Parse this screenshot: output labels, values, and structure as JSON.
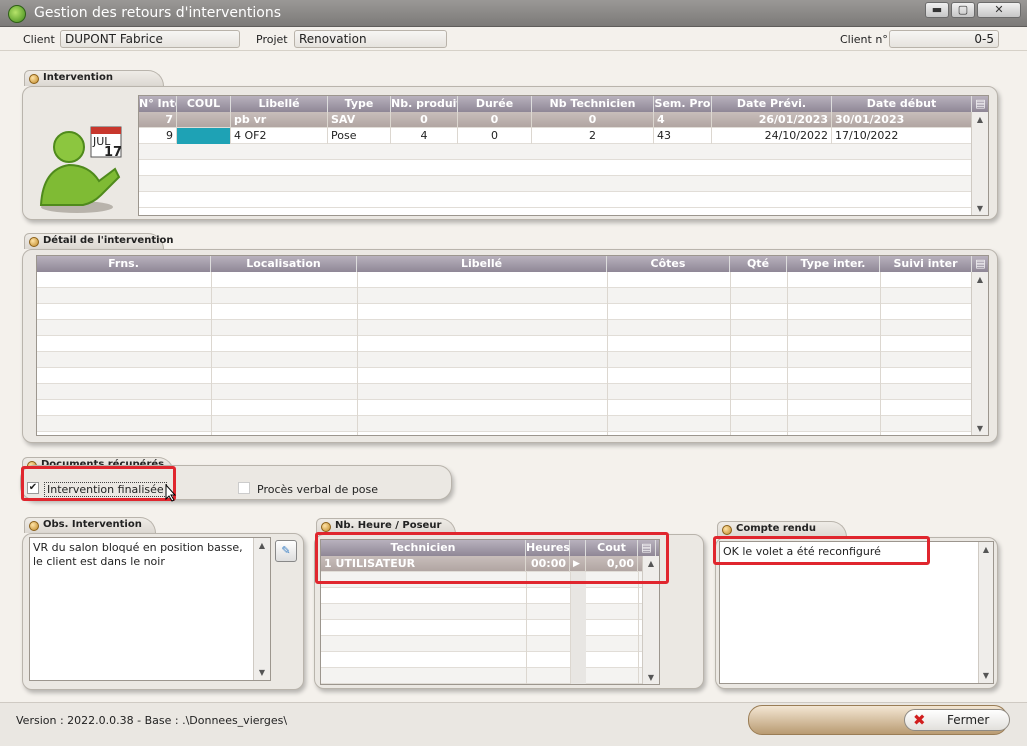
{
  "window": {
    "title": "Gestion des retours d'interventions"
  },
  "header": {
    "client_label": "Client",
    "client_value": "DUPONT Fabrice",
    "projet_label": "Projet",
    "projet_value": "Renovation",
    "client_no_label": "Client n°",
    "client_no_value": "0-5"
  },
  "intervention": {
    "title": "Intervention",
    "calendar_month": "JUL",
    "calendar_day": "17",
    "columns": [
      "N° Inte",
      "COUL",
      "Libellé",
      "Type",
      "Nb. produits",
      "Durée",
      "Nb Technicien",
      "Sem. Pro",
      "Date Prévi.",
      "Date début"
    ],
    "rows": [
      {
        "no": "7",
        "coul": "",
        "libelle": "pb vr",
        "type": "SAV",
        "nb_produits": "0",
        "duree": "0",
        "nb_technicien": "0",
        "sem_pro": "4",
        "date_previ": "26/01/2023",
        "date_debut": "30/01/2023",
        "color": ""
      },
      {
        "no": "9",
        "coul": "",
        "libelle": "4 OF2",
        "type": "Pose",
        "nb_produits": "4",
        "duree": "0",
        "nb_technicien": "2",
        "sem_pro": "43",
        "date_previ": "24/10/2022",
        "date_debut": "17/10/2022",
        "color": "#1ea2b5"
      }
    ]
  },
  "detail": {
    "title": "Détail de l'intervention",
    "columns": [
      "Frns.",
      "Localisation",
      "Libellé",
      "Côtes",
      "Qté",
      "Type inter.",
      "Suivi inter"
    ]
  },
  "documents": {
    "title": "Documents récupérés",
    "intervention_finalisee": "Intervention finalisée",
    "proces_verbal": "Procès verbal de pose"
  },
  "obs": {
    "title": "Obs. Intervention",
    "text": "VR du salon bloqué en position basse, le client est dans le noir"
  },
  "heures": {
    "title": "Nb. Heure / Poseur",
    "columns": [
      "Technicien",
      "Heures",
      "Cout"
    ],
    "rows": [
      {
        "technicien": "1 UTILISATEUR",
        "heures": "00:00",
        "cout": "0,00"
      }
    ]
  },
  "compte_rendu": {
    "title": "Compte rendu",
    "text": "OK le volet a été reconfiguré"
  },
  "footer": {
    "version": "Version : 2022.0.0.38 - Base : .\\Donnees_vierges\\",
    "fermer": "Fermer"
  },
  "colors": {
    "accent_red": "#e0262e",
    "header_purple": "#8f8796",
    "teal": "#1ea2b5"
  }
}
